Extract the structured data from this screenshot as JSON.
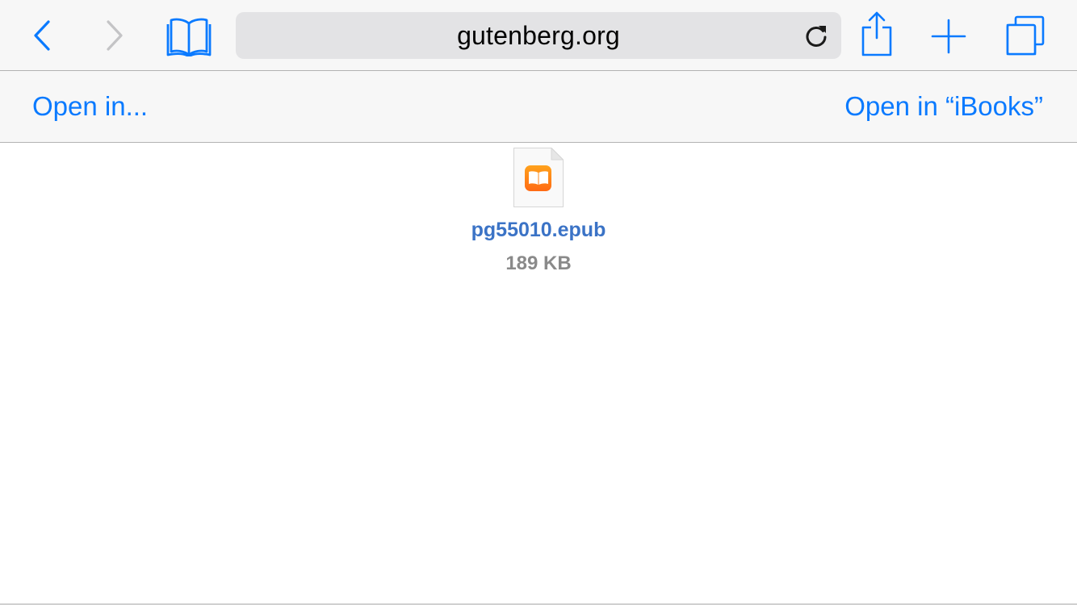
{
  "toolbar": {
    "back_icon": "chevron-left-icon",
    "forward_icon": "chevron-right-icon",
    "bookmarks_icon": "open-book-icon",
    "address": "gutenberg.org",
    "reload_icon": "reload-icon",
    "share_icon": "share-icon",
    "new_tab_icon": "plus-icon",
    "tabs_icon": "tabs-icon"
  },
  "actionbar": {
    "open_in_label": "Open in...",
    "open_in_ibooks_label": "Open in “iBooks”"
  },
  "file": {
    "icon": "ibooks-document-icon",
    "name": "pg55010.epub",
    "size": "189 KB"
  },
  "colors": {
    "accent": "#0a7aff",
    "disabled": "#c4c4c6",
    "file_name": "#3b73c6",
    "file_size": "#8a8a8a",
    "bar_bg": "#f7f7f7",
    "address_bg": "#e3e3e5"
  }
}
